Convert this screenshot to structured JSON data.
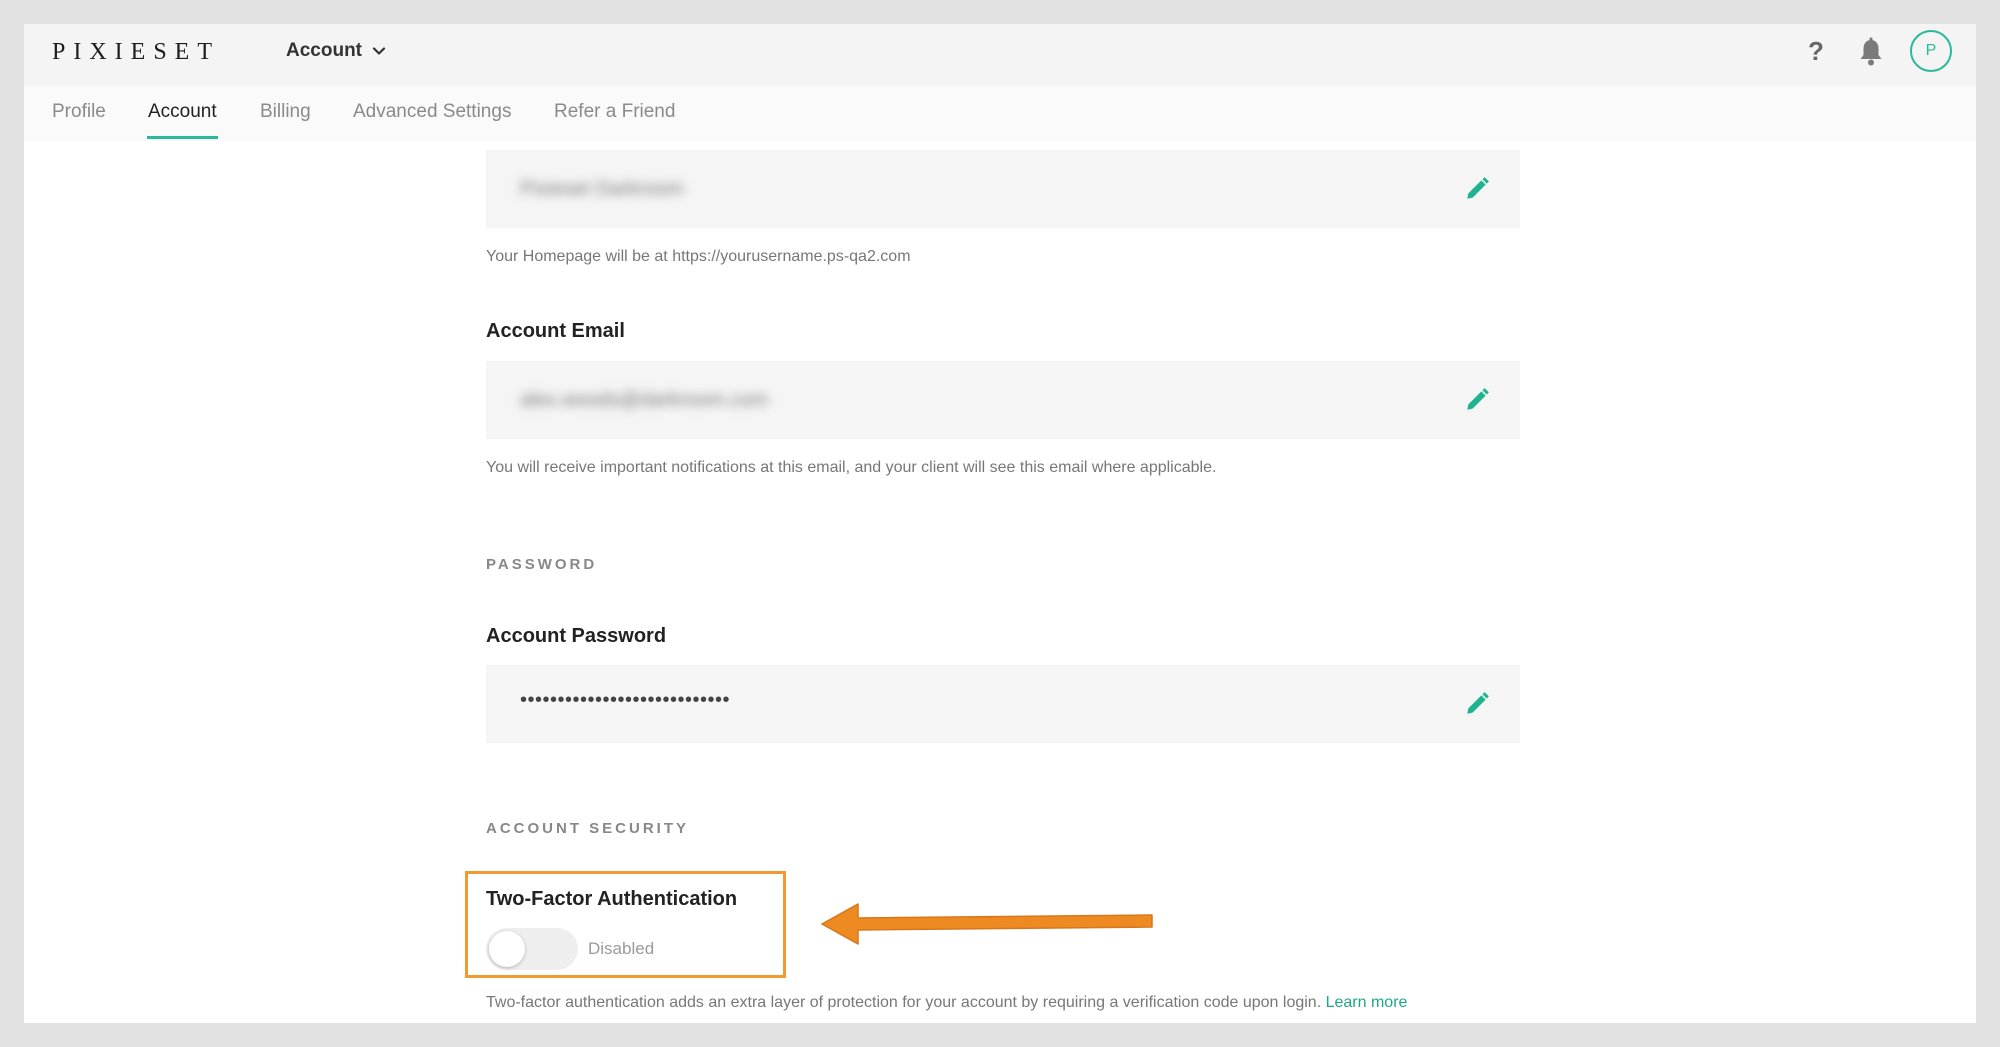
{
  "header": {
    "logo": "PIXIESET",
    "account_menu_label": "Account",
    "help_label": "?",
    "avatar_initial": "P"
  },
  "tabs": [
    {
      "label": "Profile",
      "active": false
    },
    {
      "label": "Account",
      "active": true
    },
    {
      "label": "Billing",
      "active": false
    },
    {
      "label": "Advanced Settings",
      "active": false
    },
    {
      "label": "Refer a Friend",
      "active": false
    }
  ],
  "username": {
    "value": "Pixieset Darkroom",
    "help": "Your Homepage will be at https://yourusername.ps-qa2.com"
  },
  "email": {
    "label": "Account Email",
    "value": "alex.woods@darkroom.com",
    "help": "You will receive important notifications at this email, and your client will see this email where applicable."
  },
  "password": {
    "section": "PASSWORD",
    "label": "Account Password",
    "value": "••••••••••••••••••••••••••••"
  },
  "security": {
    "section": "ACCOUNT SECURITY",
    "twofa_label": "Two-Factor Authentication",
    "twofa_state": "Disabled",
    "twofa_enabled": false,
    "twofa_desc": "Two-factor authentication adds an extra layer of protection for your account by requiring a verification code upon login.",
    "learn_more": "Learn more"
  },
  "icons": {
    "edit": "pencil-icon",
    "help": "question-icon",
    "notifications": "bell-icon",
    "menu": "chevron-down-icon"
  },
  "colors": {
    "accent": "#29b99a",
    "annotation": "#f29a30",
    "arrow": "#ee8a22"
  }
}
